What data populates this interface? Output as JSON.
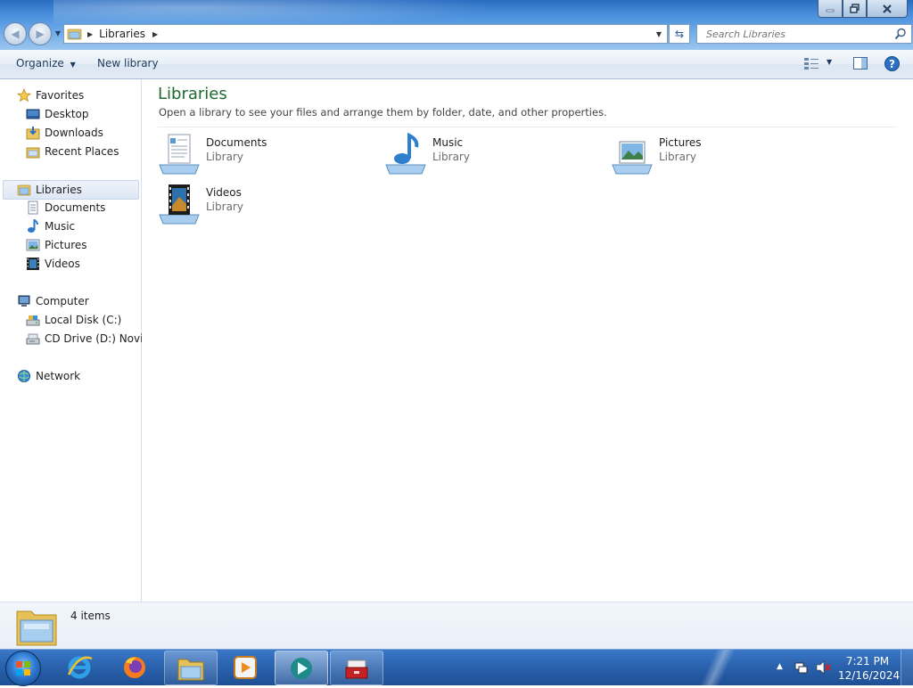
{
  "window": {
    "minimize_glyph": "—",
    "maximize_glyph": "❐",
    "close_glyph": "✕"
  },
  "address": {
    "breadcrumb": [
      "Libraries"
    ],
    "search_placeholder": "Search Libraries"
  },
  "toolbar": {
    "organize_label": "Organize",
    "new_library_label": "New library"
  },
  "navpane": {
    "favorites": {
      "label": "Favorites",
      "items": [
        {
          "label": "Desktop",
          "icon": "desktop-icon"
        },
        {
          "label": "Downloads",
          "icon": "downloads-icon"
        },
        {
          "label": "Recent Places",
          "icon": "recent-places-icon"
        }
      ]
    },
    "libraries": {
      "label": "Libraries",
      "items": [
        {
          "label": "Documents",
          "icon": "documents-icon"
        },
        {
          "label": "Music",
          "icon": "music-icon"
        },
        {
          "label": "Pictures",
          "icon": "pictures-icon"
        },
        {
          "label": "Videos",
          "icon": "videos-icon"
        }
      ]
    },
    "computer": {
      "label": "Computer",
      "items": [
        {
          "label": "Local Disk (C:)",
          "icon": "local-disk-icon"
        },
        {
          "label": "CD Drive (D:) Novide",
          "icon": "cd-drive-icon"
        }
      ]
    },
    "network": {
      "label": "Network"
    }
  },
  "content": {
    "title": "Libraries",
    "subtitle": "Open a library to see your files and arrange them by folder, date, and other properties.",
    "libraries": [
      {
        "name": "Documents",
        "kind": "Library",
        "icon": "documents-library-icon"
      },
      {
        "name": "Music",
        "kind": "Library",
        "icon": "music-library-icon"
      },
      {
        "name": "Pictures",
        "kind": "Library",
        "icon": "pictures-library-icon"
      },
      {
        "name": "Videos",
        "kind": "Library",
        "icon": "videos-library-icon"
      }
    ]
  },
  "details": {
    "count": "4 items"
  },
  "taskbar": {
    "apps": [
      {
        "name": "internet-explorer-icon"
      },
      {
        "name": "firefox-icon"
      },
      {
        "name": "windows-explorer-icon"
      },
      {
        "name": "media-player-icon"
      },
      {
        "name": "media-app-icon"
      },
      {
        "name": "toolbox-app-icon"
      }
    ],
    "clock_time": "7:21 PM",
    "clock_date": "12/16/2024"
  },
  "colors": {
    "title_green": "#1e6a2e",
    "taskbar_blue": "#2a63ad",
    "toolbar_text": "#1e395b"
  }
}
